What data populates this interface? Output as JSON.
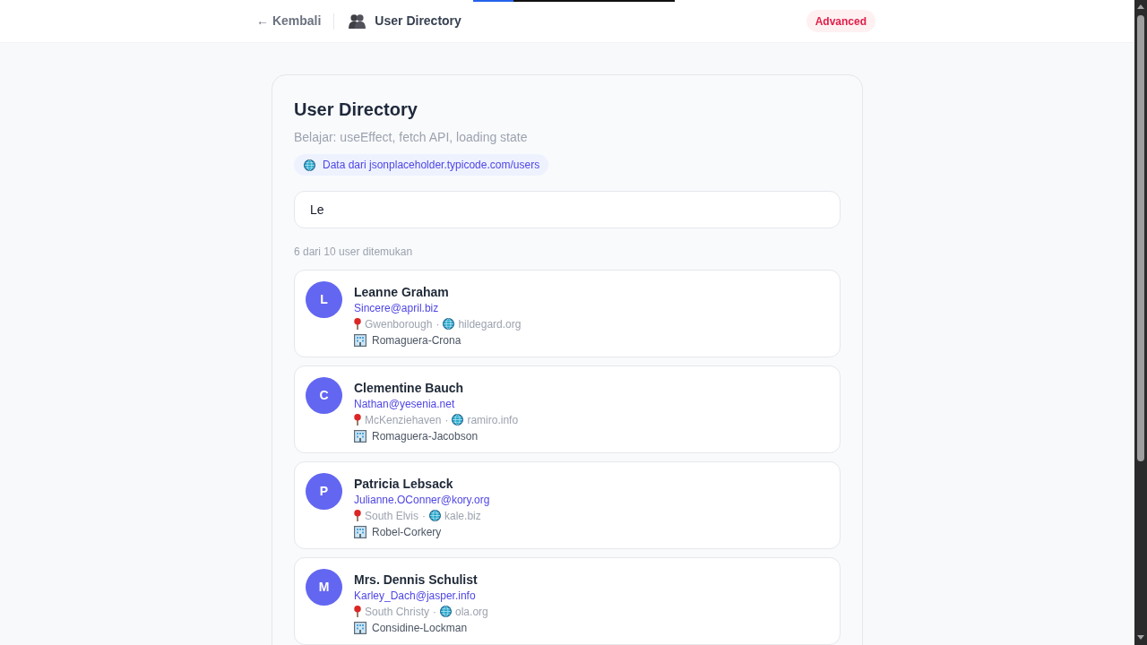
{
  "top_progress": {
    "level": 0.2
  },
  "header": {
    "back_link": "← Kembali",
    "title": "User Directory",
    "badge": "Advanced"
  },
  "card": {
    "title": "User Directory",
    "subtitle": "Belajar: useEffect, fetch API, loading state",
    "source_chip": "Data dari jsonplaceholder.typicode.com/users",
    "search": {
      "value": "Le"
    },
    "result_count": "6 dari 10 user ditemukan",
    "users": [
      {
        "initial": "L",
        "name": "Leanne Graham",
        "email": "Sincere@april.biz",
        "city": "Gwenborough",
        "separator": "·",
        "website": "hildegard.org",
        "company": "Romaguera-Crona"
      },
      {
        "initial": "C",
        "name": "Clementine Bauch",
        "email": "Nathan@yesenia.net",
        "city": "McKenziehaven",
        "separator": "·",
        "website": "ramiro.info",
        "company": "Romaguera-Jacobson"
      },
      {
        "initial": "P",
        "name": "Patricia Lebsack",
        "email": "Julianne.OConner@kory.org",
        "city": "South Elvis",
        "separator": "·",
        "website": "kale.biz",
        "company": "Robel-Corkery"
      },
      {
        "initial": "M",
        "name": "Mrs. Dennis Schulist",
        "email": "Karley_Dach@jasper.info",
        "city": "South Christy",
        "separator": "·",
        "website": "ola.org",
        "company": "Considine-Lockman"
      }
    ]
  }
}
